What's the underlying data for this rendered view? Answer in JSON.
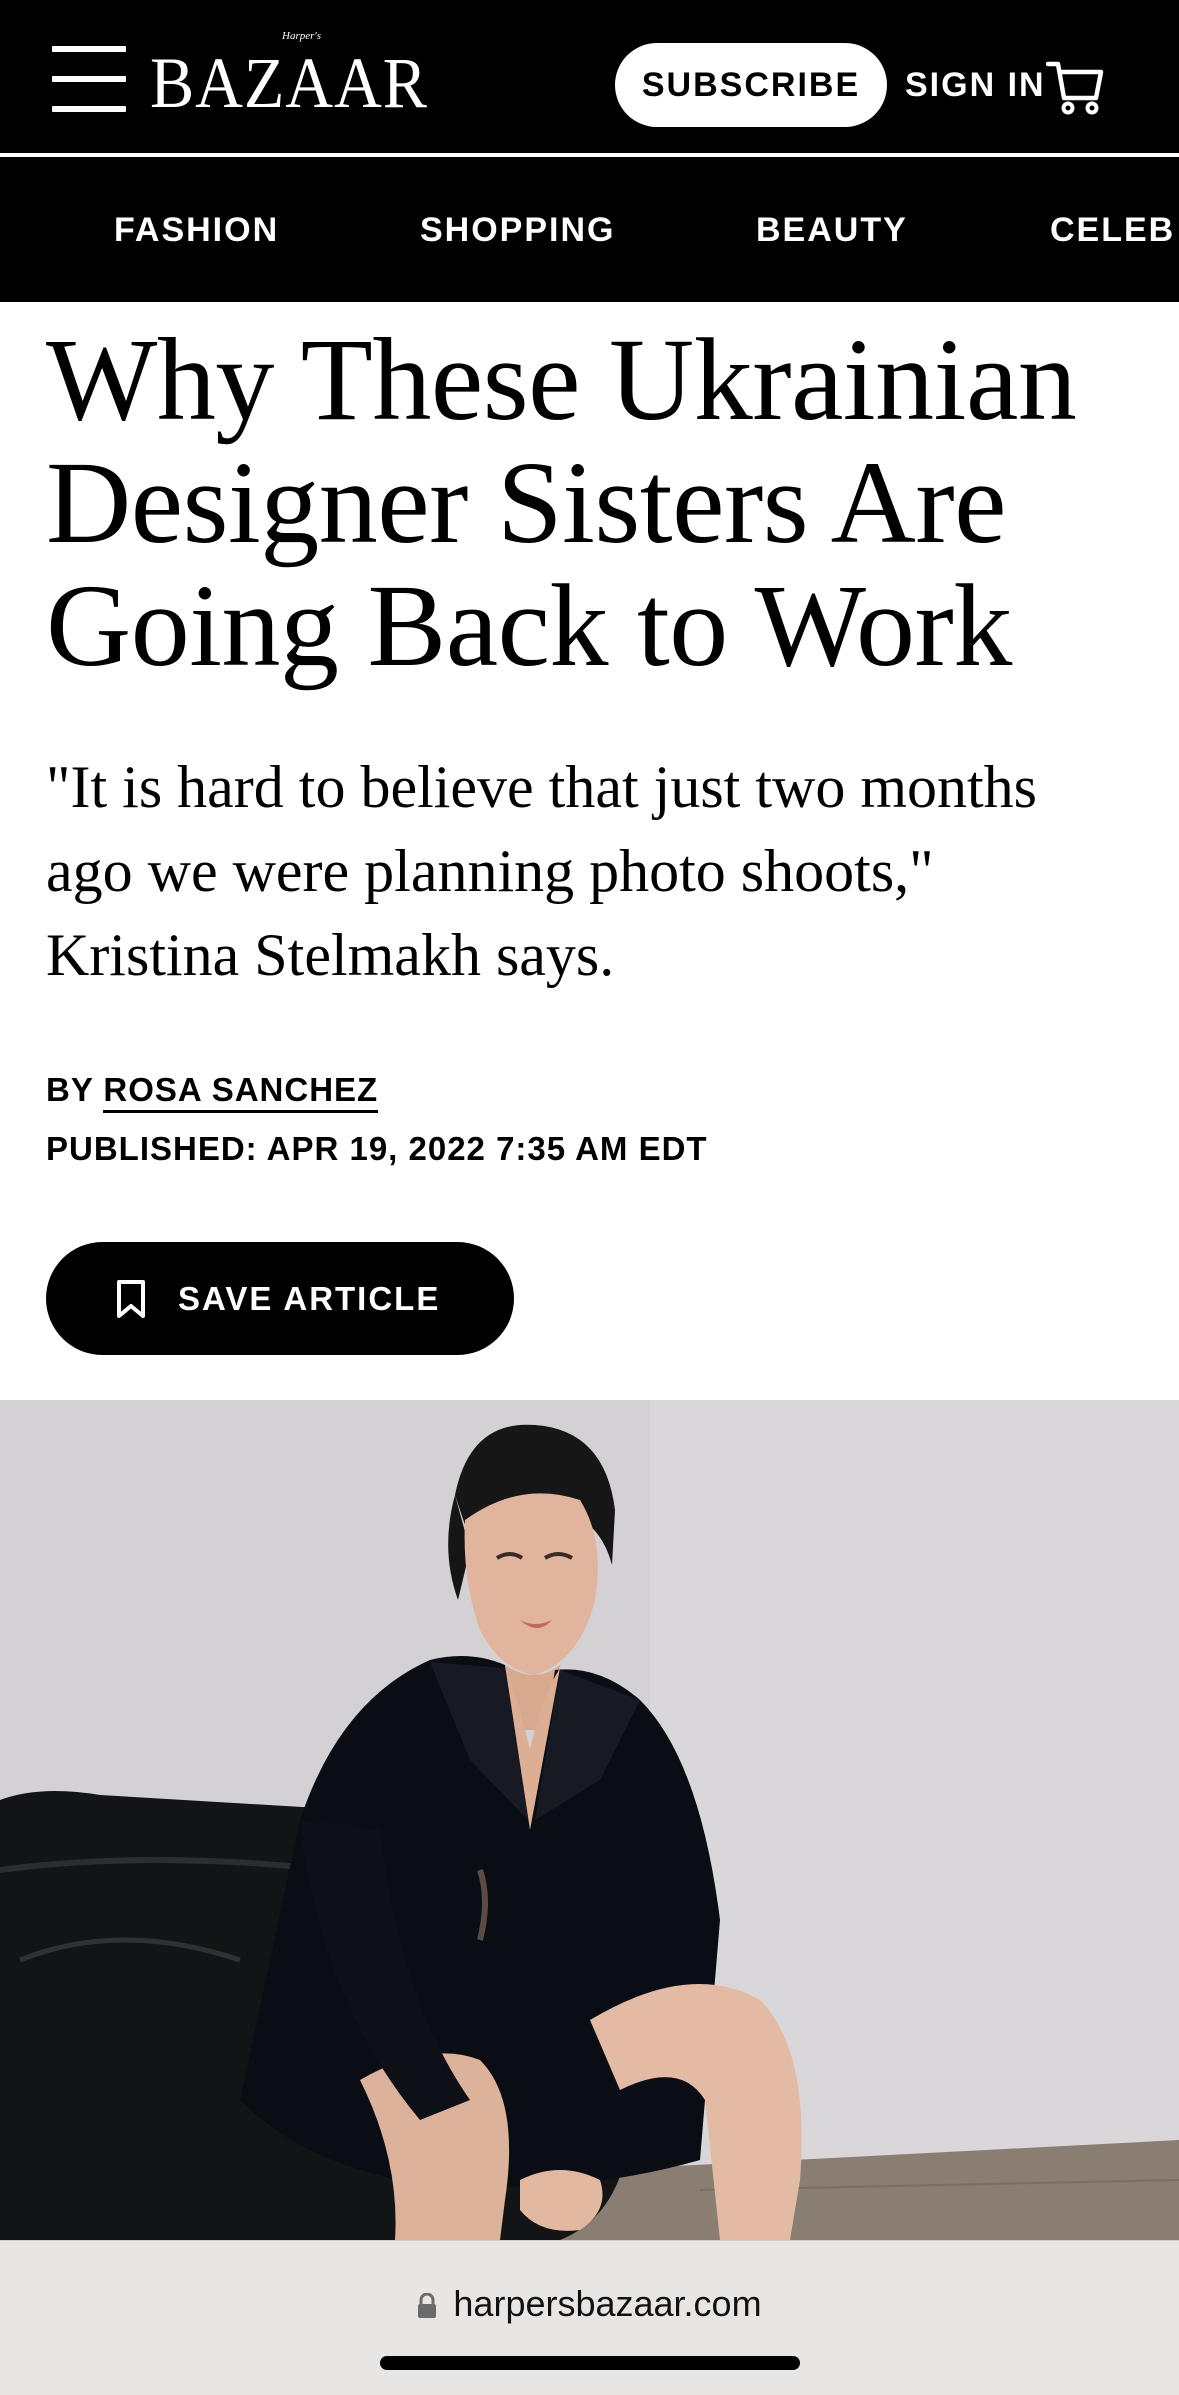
{
  "header": {
    "logo_text": "BAZAAR",
    "logo_small": "Harper's",
    "subscribe_label": "SUBSCRIBE",
    "signin_label": "SIGN IN",
    "menu_icon": "hamburger-icon",
    "cart_icon": "cart-icon"
  },
  "nav": {
    "items": [
      {
        "label": "FASHION"
      },
      {
        "label": "SHOPPING"
      },
      {
        "label": "BEAUTY"
      },
      {
        "label": "CELEB"
      }
    ]
  },
  "article": {
    "headline_lines": [
      "Why These Ukrainian",
      "Designer Sisters Are",
      "Going Back to Work"
    ],
    "dek_lines": [
      "\"It is hard to believe that just two months",
      "ago we were planning photo shoots,\"",
      "Kristina Stelmakh says."
    ],
    "byline_prefix": "BY",
    "author": "ROSA SANCHEZ",
    "published": "PUBLISHED: APR 19, 2022 7:35 AM EDT",
    "save_label": "SAVE ARTICLE",
    "save_icon": "bookmark-icon"
  },
  "browser": {
    "url": "harpersbazaar.com",
    "lock_icon": "lock-icon"
  },
  "colors": {
    "header_bg": "#000000",
    "page_bg": "#ffffff",
    "urlbar_bg": "#e8e6e4"
  }
}
